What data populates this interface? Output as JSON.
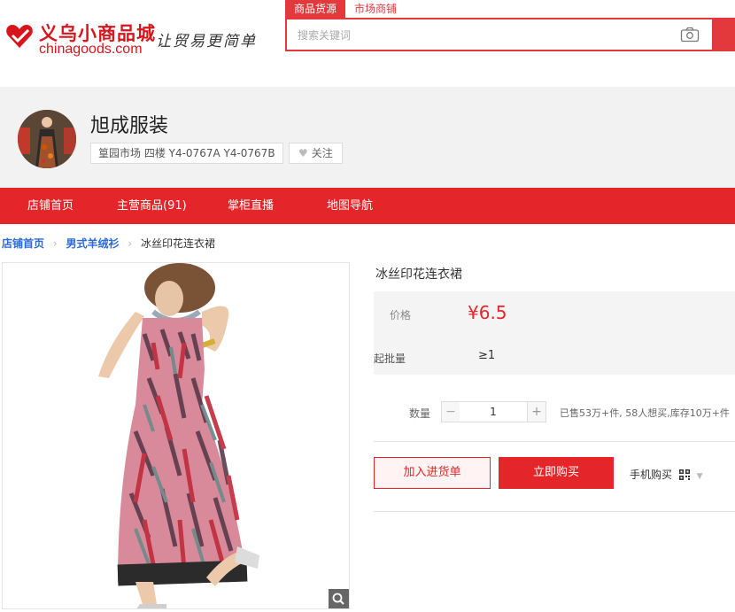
{
  "site": {
    "name_cn": "义乌小商品城",
    "name_en": "chinagoods.com",
    "slogan": "让贸易更简单",
    "colors": {
      "brand": "#e4262a",
      "link": "#2a6ad6"
    }
  },
  "search": {
    "tabs": [
      "商品货源",
      "市场商铺"
    ],
    "active_tab": "商品货源",
    "placeholder": "搜索关键词",
    "camera_icon": "camera-icon"
  },
  "shop": {
    "name": "旭成服装",
    "address": "篁园市场 四楼 Y4-0767A Y4-0767B",
    "follow_label": "关注"
  },
  "nav": {
    "items": [
      "店铺首页",
      "主营商品(91)",
      "掌柜直播",
      "地图导航"
    ]
  },
  "breadcrumb": {
    "home": "店铺首页",
    "category": "男式羊绒衫",
    "current": "冰丝印花连衣裙"
  },
  "product": {
    "title": "冰丝印花连衣裙",
    "price_label": "价格",
    "price": "¥6.5",
    "moq_label": "起批量",
    "moq": "≥1",
    "qty_label": "数量",
    "qty_minus": "−",
    "qty_value": "1",
    "qty_plus": "+",
    "sold_info": "已售53万+件, 58人想买,库存10万+件",
    "cart_label": "加入进货单",
    "buy_label": "立即购买",
    "mobile_buy_label": "手机购买"
  }
}
